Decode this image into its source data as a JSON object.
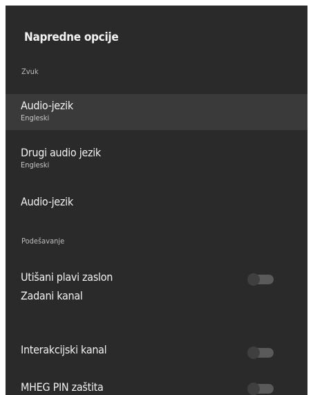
{
  "panel": {
    "title": "Napredne opcije"
  },
  "sections": {
    "sound": "Zvuk",
    "settings": "Podešavanje"
  },
  "items": [
    {
      "label": "Audio-jezik",
      "sub": "Engleski",
      "selected": true
    },
    {
      "label": "Drugi audio jezik",
      "sub": "Engleski"
    },
    {
      "label": "Audio-jezik"
    },
    {
      "label": "Utišani plavi zaslon",
      "toggle": "off"
    },
    {
      "label": "Zadani kanal"
    },
    {
      "label": "Interakcijski kanal",
      "toggle": "off"
    },
    {
      "label": "MHEG PIN zaštita",
      "toggle": "off"
    }
  ]
}
